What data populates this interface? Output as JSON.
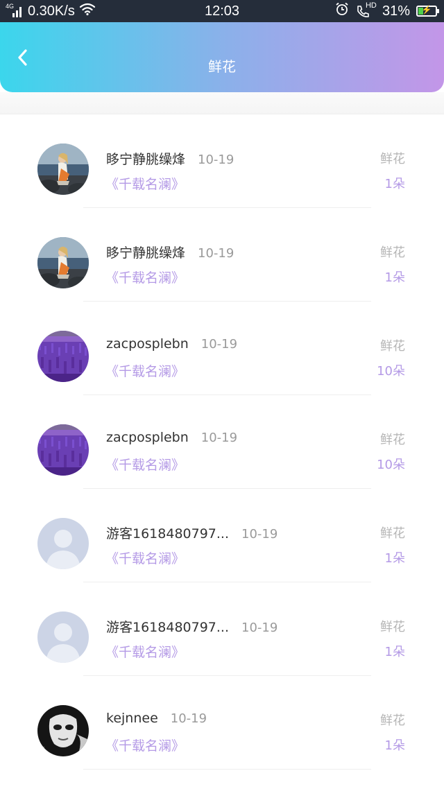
{
  "status_bar": {
    "network": "4G",
    "speed": "0.30K/s",
    "time": "12:03",
    "hd_label": "HD",
    "battery_percent": "31%",
    "battery_level": 0.31
  },
  "header": {
    "title": "鲜花"
  },
  "items": [
    {
      "name": "眵宁静朓缲烽",
      "date": "10-19",
      "work": "《千载名澜》",
      "type": "鲜花",
      "count": "1朵",
      "avatar": "woman-photo"
    },
    {
      "name": "眵宁静朓缲烽",
      "date": "10-19",
      "work": "《千载名澜》",
      "type": "鲜花",
      "count": "1朵",
      "avatar": "woman-photo"
    },
    {
      "name": "zacposplebn",
      "date": "10-19",
      "work": "《千载名澜》",
      "type": "鲜花",
      "count": "10朵",
      "avatar": "lavender-photo"
    },
    {
      "name": "zacposplebn",
      "date": "10-19",
      "work": "《千载名澜》",
      "type": "鲜花",
      "count": "10朵",
      "avatar": "lavender-photo"
    },
    {
      "name": "游客1618480797...",
      "date": "10-19",
      "work": "《千载名澜》",
      "type": "鲜花",
      "count": "1朵",
      "avatar": "default-user"
    },
    {
      "name": "游客1618480797...",
      "date": "10-19",
      "work": "《千载名澜》",
      "type": "鲜花",
      "count": "1朵",
      "avatar": "default-user"
    },
    {
      "name": "kejnnee",
      "date": "10-19",
      "work": "《千载名澜》",
      "type": "鲜花",
      "count": "1朵",
      "avatar": "mask-photo"
    }
  ],
  "colors": {
    "header_gradient": [
      "#3bd6ec",
      "#8ab1ea",
      "#c396e8"
    ],
    "accent": "#b49ae6",
    "status_bar": "#252d3a"
  }
}
